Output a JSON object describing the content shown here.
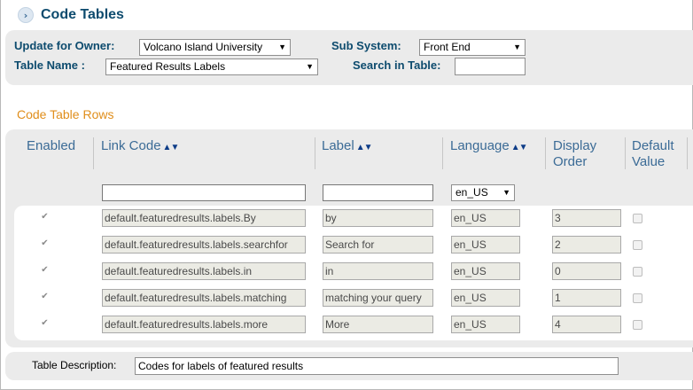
{
  "page": {
    "title": "Code Tables"
  },
  "filters": {
    "owner_label": "Update for Owner:",
    "owner_value": "Volcano Island University",
    "subsystem_label": "Sub System:",
    "subsystem_value": "Front End",
    "table_name_label": "Table Name :",
    "table_name_value": "Featured Results Labels",
    "search_label": "Search in Table:",
    "search_value": ""
  },
  "section": {
    "title": "Code Table Rows"
  },
  "columns": {
    "enabled": "Enabled",
    "link_code": "Link Code",
    "label": "Label",
    "language": "Language",
    "display_order_line1": "Display",
    "display_order_line2": "Order",
    "default_value_line1": "Default",
    "default_value_line2": "Value",
    "sort_glyph": "▲▼"
  },
  "filter_row": {
    "link_code": "",
    "label": "",
    "language": "en_US"
  },
  "rows": [
    {
      "enabled": true,
      "link_code": "default.featuredresults.labels.By",
      "label": "by",
      "language": "en_US",
      "order": "3",
      "default": false
    },
    {
      "enabled": true,
      "link_code": "default.featuredresults.labels.searchfor",
      "label": "Search for",
      "language": "en_US",
      "order": "2",
      "default": false
    },
    {
      "enabled": true,
      "link_code": "default.featuredresults.labels.in",
      "label": "in",
      "language": "en_US",
      "order": "0",
      "default": false
    },
    {
      "enabled": true,
      "link_code": "default.featuredresults.labels.matching",
      "label": "matching your query",
      "language": "en_US",
      "order": "1",
      "default": false
    },
    {
      "enabled": true,
      "link_code": "default.featuredresults.labels.more",
      "label": "More",
      "language": "en_US",
      "order": "4",
      "default": false
    }
  ],
  "description": {
    "label": "Table Description:",
    "value": "Codes for labels of featured results"
  },
  "icons": {
    "title_icon": "chevron-right-icon",
    "dropdown_icon": "dropdown-arrow-icon",
    "check_icon": "checkmark-icon"
  }
}
